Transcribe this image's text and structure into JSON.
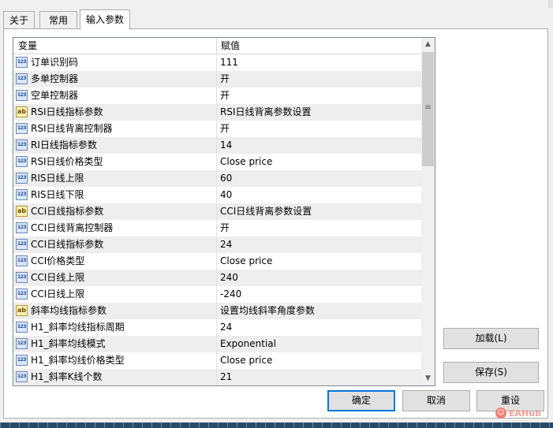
{
  "tabs": [
    {
      "label": "关于",
      "active": false
    },
    {
      "label": "常用",
      "active": false
    },
    {
      "label": "输入参数",
      "active": true
    }
  ],
  "grid": {
    "headers": {
      "variable": "变量",
      "value": "赋值"
    },
    "rows": [
      {
        "type": "int",
        "icon": "123",
        "name": "订单识别码",
        "value": "111"
      },
      {
        "type": "int",
        "icon": "123",
        "name": "多单控制器",
        "value": "开"
      },
      {
        "type": "int",
        "icon": "123",
        "name": "空单控制器",
        "value": "开"
      },
      {
        "type": "string",
        "icon": "ab",
        "name": "RSI日线指标参数",
        "value": "RSI日线背离参数设置"
      },
      {
        "type": "int",
        "icon": "123",
        "name": "RSI日线背离控制器",
        "value": "开"
      },
      {
        "type": "int",
        "icon": "123",
        "name": "RI日线指标参数",
        "value": "14"
      },
      {
        "type": "int",
        "icon": "123",
        "name": "RSI日线价格类型",
        "value": "Close price"
      },
      {
        "type": "int",
        "icon": "123",
        "name": "RIS日线上限",
        "value": "60"
      },
      {
        "type": "int",
        "icon": "123",
        "name": "RIS日线下限",
        "value": "40"
      },
      {
        "type": "string",
        "icon": "ab",
        "name": "CCI日线指标参数",
        "value": "CCI日线背离参数设置"
      },
      {
        "type": "int",
        "icon": "123",
        "name": "CCI日线背离控制器",
        "value": "开"
      },
      {
        "type": "int",
        "icon": "123",
        "name": "CCI日线指标参数",
        "value": "24"
      },
      {
        "type": "int",
        "icon": "123",
        "name": "CCI价格类型",
        "value": "Close price"
      },
      {
        "type": "int",
        "icon": "123",
        "name": "CCI日线上限",
        "value": "240"
      },
      {
        "type": "int",
        "icon": "123",
        "name": "CCI日线上限",
        "value": "-240"
      },
      {
        "type": "string",
        "icon": "ab",
        "name": "斜率均线指标参数",
        "value": "设置均线斜率角度参数"
      },
      {
        "type": "int",
        "icon": "123",
        "name": "H1_斜率均线指标周期",
        "value": "24"
      },
      {
        "type": "int",
        "icon": "123",
        "name": "H1_斜率均线模式",
        "value": "Exponential"
      },
      {
        "type": "int",
        "icon": "123",
        "name": "H1_斜率均线价格类型",
        "value": "Close price"
      },
      {
        "type": "int",
        "icon": "123",
        "name": "H1_斜率K线个数",
        "value": "21"
      }
    ]
  },
  "scrollbar": {
    "position": 0.0,
    "up_icon": "chevron-up-icon",
    "down_icon": "chevron-down-icon",
    "grip_icon": "grip-icon"
  },
  "buttons": {
    "load": "加载(L)",
    "save": "保存(S)",
    "ok": "确定",
    "cancel": "取消",
    "reset": "重设"
  },
  "watermark": {
    "text": "EAHub"
  },
  "colors": {
    "accent": "#0078d7",
    "row_alt": "#eeeeee",
    "border": "#adadad"
  }
}
